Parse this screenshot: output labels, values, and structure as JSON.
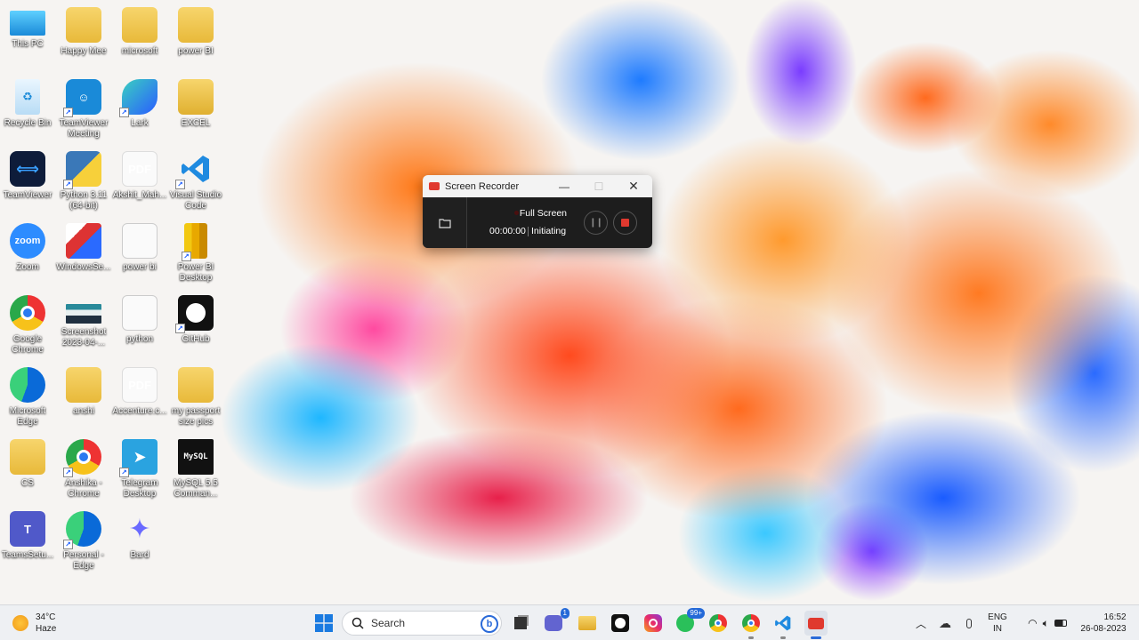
{
  "desktop": {
    "icons": [
      {
        "label": "This PC",
        "icon": "monitor-icon"
      },
      {
        "label": "Happy Mee",
        "icon": "folder-icon"
      },
      {
        "label": "microsoft",
        "icon": "folder-icon"
      },
      {
        "label": "power BI",
        "icon": "folder-icon"
      },
      {
        "label": "Recycle Bin",
        "icon": "recycle-bin-icon"
      },
      {
        "label": "TeamViewer Meeting",
        "icon": "teamviewer-meeting-icon"
      },
      {
        "label": "Lark",
        "icon": "lark-icon"
      },
      {
        "label": "EXCEL",
        "icon": "folder-icon"
      },
      {
        "label": "TeamViewer",
        "icon": "teamviewer-icon"
      },
      {
        "label": "Python 3.11 (64-bit)",
        "icon": "python-icon"
      },
      {
        "label": "Akshit_Mah...",
        "icon": "pdf-icon"
      },
      {
        "label": "Visual Studio Code",
        "icon": "vscode-icon"
      },
      {
        "label": "Zoom",
        "icon": "zoom-icon"
      },
      {
        "label": "WindowsSe...",
        "icon": "windows-security-icon"
      },
      {
        "label": "power bi",
        "icon": "document-icon"
      },
      {
        "label": "Power BI Desktop",
        "icon": "power-bi-icon"
      },
      {
        "label": "Google Chrome",
        "icon": "chrome-icon"
      },
      {
        "label": "Screenshot 2023-04-...",
        "icon": "image-file-icon"
      },
      {
        "label": "python",
        "icon": "document-icon"
      },
      {
        "label": "GitHub",
        "icon": "github-icon"
      },
      {
        "label": "Microsoft Edge",
        "icon": "edge-icon"
      },
      {
        "label": "anshi",
        "icon": "folder-icon"
      },
      {
        "label": "Accenture.c...",
        "icon": "pdf-icon"
      },
      {
        "label": "my passport size pics",
        "icon": "folder-icon"
      },
      {
        "label": "CS",
        "icon": "folder-icon"
      },
      {
        "label": "Anshika - Chrome",
        "icon": "chrome-profile-icon"
      },
      {
        "label": "Telegram Desktop",
        "icon": "telegram-icon"
      },
      {
        "label": "MySQL 5.5 Comman...",
        "icon": "mysql-icon"
      },
      {
        "label": "TeamsSetu...",
        "icon": "teams-icon"
      },
      {
        "label": "Personal - Edge",
        "icon": "edge-profile-icon"
      },
      {
        "label": "Bard",
        "icon": "bard-icon"
      }
    ],
    "pdf_label": "PDF",
    "zoom_text": "zoom",
    "mysql_text": "MySQL"
  },
  "recorder": {
    "title": "Screen Recorder",
    "mode": "Full Screen",
    "time": "00:00:00",
    "status": "Initiating",
    "accent": "#e0392f"
  },
  "taskbar": {
    "weather_temp": "34°C",
    "weather_desc": "Haze",
    "search_label": "Search",
    "teams_badge": "1",
    "whatsapp_badge": "99+",
    "language_top": "ENG",
    "language_bottom": "IN",
    "time": "16:52",
    "date": "26-08-2023"
  }
}
